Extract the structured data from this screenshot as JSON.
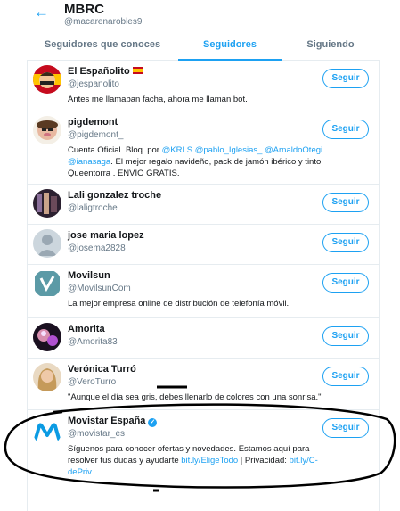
{
  "header": {
    "title": "MBRC",
    "handle": "@macarenarobles9",
    "back_icon": "←"
  },
  "tabs": [
    {
      "label": "Seguidores que conoces"
    },
    {
      "label": "Seguidores"
    },
    {
      "label": "Siguiendo"
    }
  ],
  "follow_label": "Seguir",
  "colors": {
    "accent": "#1da1f2",
    "text": "#14171a",
    "muted": "#657786"
  },
  "users": [
    {
      "name": "El Españolito",
      "handle": "@jespanolito",
      "bio": "Antes me llamaban facha, ahora me llaman bot."
    },
    {
      "name": "pigdemont",
      "handle": "@pigdemont_",
      "bio_prefix": "Cuenta Oficial. Bloq. por ",
      "bio_links": [
        "@KRLS",
        "@pablo_Iglesias_",
        "@ArnaldoOtegi",
        "@ianasaga"
      ],
      "bio_suffix": ". El mejor regalo navideño, pack de jamón ibérico y tinto Queentorra . ENVÍO GRATIS."
    },
    {
      "name": "Lali gonzalez troche",
      "handle": "@laligtroche",
      "bio": ""
    },
    {
      "name": "jose maria lopez",
      "handle": "@josema2828",
      "bio": ""
    },
    {
      "name": "Movilsun",
      "handle": "@MovilsunCom",
      "bio": "La mejor empresa online de distribución de telefonía móvil."
    },
    {
      "name": "Amorita",
      "handle": "@Amorita83",
      "bio": ""
    },
    {
      "name": "Verónica Turró",
      "handle": "@VeroTurro",
      "bio": "\"Aunque el día sea gris, debes llenarlo de colores con una sonrisa.\""
    },
    {
      "name": "Movistar España",
      "handle": "@movistar_es",
      "bio_prefix": "Síguenos para conocer ofertas y novedades. Estamos aquí para resolver tus dudas y ayudarte ",
      "bio_link1": "bit.ly/EligeTodo",
      "bio_mid": " | Privacidad: ",
      "bio_link2": "bit.ly/C-dePriv"
    }
  ]
}
